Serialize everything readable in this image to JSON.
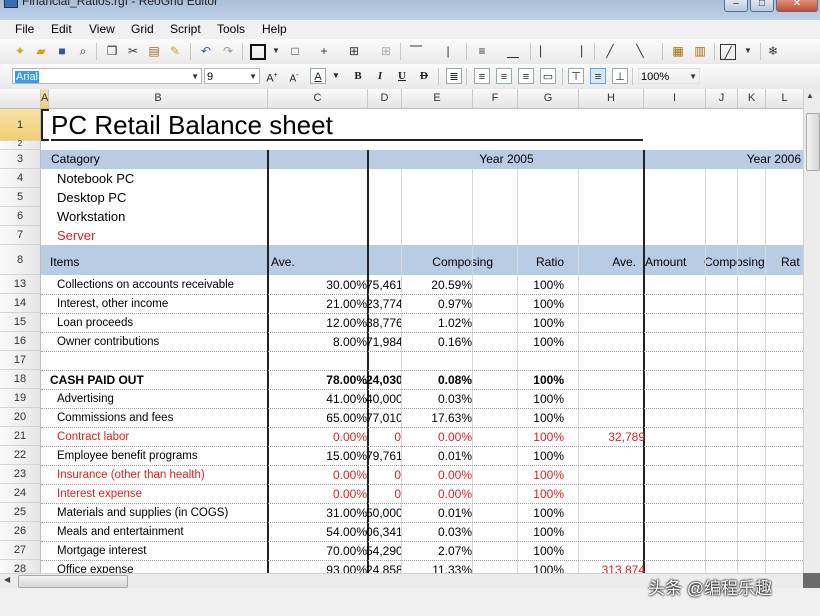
{
  "window": {
    "title": "Financial_Ratios.rgf - ReoGrid Editor",
    "min_icon": "minimize-icon",
    "max_icon": "maximize-icon",
    "close_icon": "close-icon"
  },
  "menu": [
    "File",
    "Edit",
    "View",
    "Grid",
    "Script",
    "Tools",
    "Help"
  ],
  "toolbar2": {
    "font": "Arial",
    "size": "9",
    "zoom": "100%",
    "bold": "B",
    "italic": "I",
    "underline": "U",
    "strike": "D"
  },
  "columns": [
    "A",
    "B",
    "C",
    "D",
    "E",
    "F",
    "G",
    "H",
    "I",
    "J",
    "K",
    "L"
  ],
  "sheet": {
    "title": "PC Retail Balance sheet",
    "catagory": "Catagory",
    "year1": "Year 2005",
    "year2": "Year 2006",
    "categories": [
      "Notebook PC",
      "Desktop PC",
      "Workstation",
      "Server"
    ],
    "items_header": {
      "items": "Items",
      "ave1": "Ave.",
      "composing1": "Composing",
      "ratio1": "Ratio",
      "ave2": "Ave.",
      "amount2": "Amount",
      "composing2": "Composing",
      "ratio2": "Rat"
    },
    "rows": [
      {
        "n": "13",
        "label": "Collections on accounts receivable",
        "pct": "30.00%",
        "amt": "75,461",
        "comp": "20.59%",
        "ratio": "100%",
        "h": "",
        "red": false,
        "bold": false
      },
      {
        "n": "14",
        "label": "Interest, other income",
        "pct": "21.00%",
        "amt": "23,774",
        "comp": "0.97%",
        "ratio": "100%",
        "h": "",
        "red": false,
        "bold": false
      },
      {
        "n": "15",
        "label": "Loan proceeds",
        "pct": "12.00%",
        "amt": "38,776",
        "comp": "1.02%",
        "ratio": "100%",
        "h": "",
        "red": false,
        "bold": false
      },
      {
        "n": "16",
        "label": "Owner contributions",
        "pct": "8.00%",
        "amt": "71,984",
        "comp": "0.16%",
        "ratio": "100%",
        "h": "",
        "red": false,
        "bold": false
      },
      {
        "n": "17",
        "label": "",
        "pct": "",
        "amt": "",
        "comp": "",
        "ratio": "",
        "h": "",
        "red": false,
        "bold": false
      },
      {
        "n": "18",
        "label": "CASH PAID OUT",
        "pct": "78.00%",
        "amt": "24,030",
        "comp": "0.08%",
        "ratio": "100%",
        "h": "",
        "red": false,
        "bold": true
      },
      {
        "n": "19",
        "label": "Advertising",
        "pct": "41.00%",
        "amt": "40,000",
        "comp": "0.03%",
        "ratio": "100%",
        "h": "",
        "red": false,
        "bold": false
      },
      {
        "n": "20",
        "label": "Commissions and fees",
        "pct": "65.00%",
        "amt": "77,010",
        "comp": "17.63%",
        "ratio": "100%",
        "h": "",
        "red": false,
        "bold": false
      },
      {
        "n": "21",
        "label": "Contract labor",
        "pct": "0.00%",
        "amt": "0",
        "comp": "0.00%",
        "ratio": "100%",
        "h": "32,789",
        "red": true,
        "bold": false
      },
      {
        "n": "22",
        "label": "Employee benefit programs",
        "pct": "15.00%",
        "amt": "79,761",
        "comp": "0.01%",
        "ratio": "100%",
        "h": "",
        "red": false,
        "bold": false
      },
      {
        "n": "23",
        "label": "Insurance (other than health)",
        "pct": "0.00%",
        "amt": "0",
        "comp": "0.00%",
        "ratio": "100%",
        "h": "",
        "red": true,
        "bold": false
      },
      {
        "n": "24",
        "label": "Interest expense",
        "pct": "0.00%",
        "amt": "0",
        "comp": "0.00%",
        "ratio": "100%",
        "h": "",
        "red": true,
        "bold": false
      },
      {
        "n": "25",
        "label": "Materials and supplies (in COGS)",
        "pct": "31.00%",
        "amt": "50,000",
        "comp": "0.01%",
        "ratio": "100%",
        "h": "",
        "red": false,
        "bold": false
      },
      {
        "n": "26",
        "label": "Meals and entertainment",
        "pct": "54.00%",
        "amt": "06,341",
        "comp": "0.03%",
        "ratio": "100%",
        "h": "",
        "red": false,
        "bold": false
      },
      {
        "n": "27",
        "label": "Mortgage interest",
        "pct": "70.00%",
        "amt": "54,290",
        "comp": "2.07%",
        "ratio": "100%",
        "h": "",
        "red": false,
        "bold": false
      },
      {
        "n": "28",
        "label": "Office expense",
        "pct": "93.00%",
        "amt": "24,858",
        "comp": "11.33%",
        "ratio": "100%",
        "h": "313,874",
        "red": false,
        "bold": false
      }
    ]
  },
  "watermark": "头条 @编程乐趣",
  "colors": {
    "header_band": "#b8cce4",
    "red": "#e02020",
    "selected_header": "#f1cf72"
  }
}
